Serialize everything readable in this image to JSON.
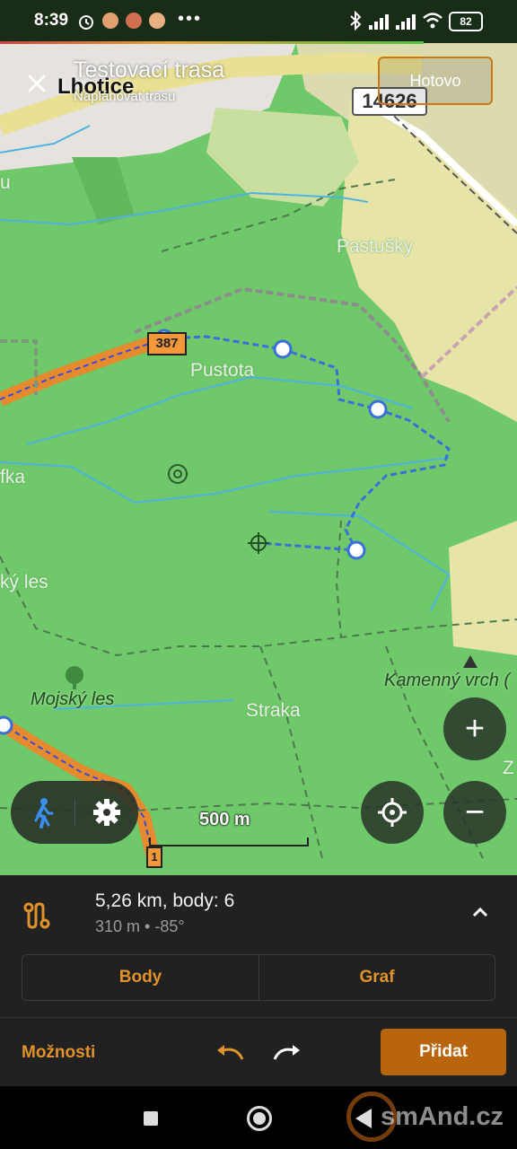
{
  "status_bar": {
    "time": "8:39",
    "more": "•••",
    "battery": "82"
  },
  "header": {
    "title": "Testovací trasa",
    "subtitle": "Naplánovat trasu",
    "done_label": "Hotovo",
    "close_icon": "close-icon"
  },
  "map": {
    "labels": {
      "lhotice": "Lhotice",
      "pastusky": "Pastušky",
      "pustota": "Pustota",
      "straka": "Straka",
      "mojsky_les": "Mojský les",
      "mojsky_les_partial": "ký les",
      "kamenny_vrch": "Kamenný vrch (",
      "fka": "fka",
      "u": "u",
      "z": "Z"
    },
    "road_numbers": {
      "r14626": "14626",
      "r387": "387",
      "r1": "1"
    },
    "scale": "500 m",
    "colors": {
      "forest": "#6fc86a",
      "field": "#e9e8b0",
      "route": "#3a6fd8",
      "main_road": "#e58a2d",
      "water": "#4fb3e0"
    }
  },
  "controls": {
    "zoom_in": "+",
    "zoom_out": "−",
    "locate_icon": "crosshair-icon",
    "profile_icon": "pedestrian-icon",
    "settings_icon": "gear-icon"
  },
  "route_sheet": {
    "summary": "5,26 km, body: 6",
    "details": "310 m • -85°",
    "tabs": [
      "Body",
      "Graf"
    ],
    "options_label": "Možnosti",
    "add_label": "Přidat",
    "accent_color": "#e0922b"
  },
  "watermark": "smAnd.cz"
}
